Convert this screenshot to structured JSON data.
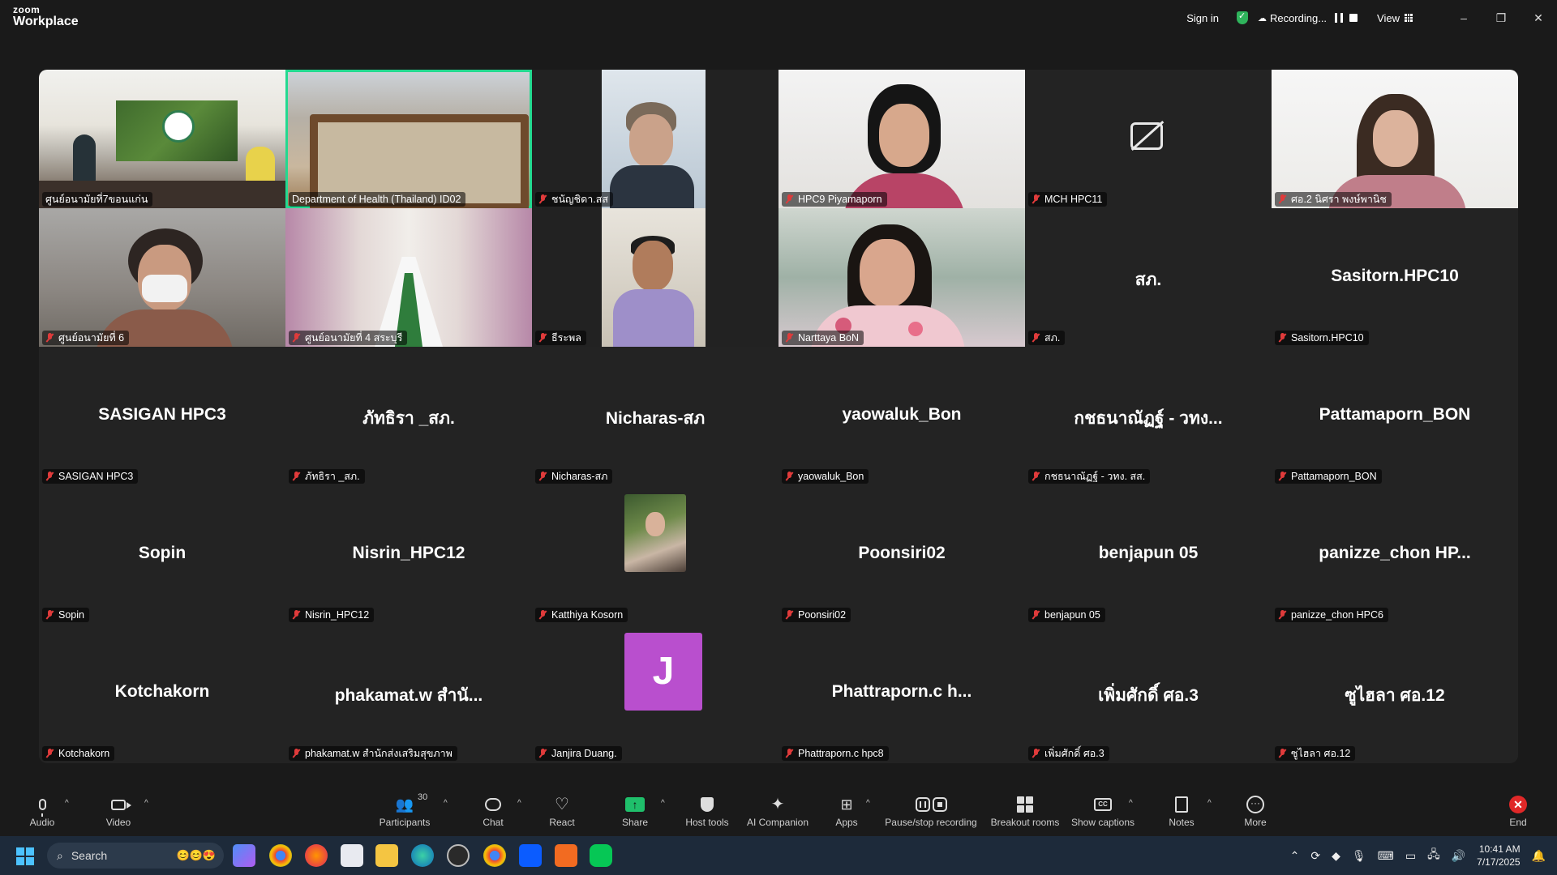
{
  "app": {
    "brand_top": "zoom",
    "brand_bottom": "Workplace"
  },
  "titlebar": {
    "signin": "Sign in",
    "recording": "Recording...",
    "view": "View",
    "minimize": "–",
    "restore": "❐",
    "close": "✕"
  },
  "tiles": [
    {
      "label": "ศูนย์อนามัยที่7ขอนแก่น",
      "big": "",
      "type": "video",
      "muted": false
    },
    {
      "label": "Department of Health (Thailand) ID02",
      "big": "",
      "type": "video",
      "muted": false,
      "active": true
    },
    {
      "label": "ชนัญชิดา.สส",
      "big": "",
      "type": "video",
      "muted": true
    },
    {
      "label": "HPC9 Piyamaporn",
      "big": "",
      "type": "video",
      "muted": true
    },
    {
      "label": "MCH HPC11",
      "big": "",
      "type": "camoff",
      "muted": true
    },
    {
      "label": "ศอ.2 นิศรา พงษ์พานิช",
      "big": "",
      "type": "video",
      "muted": true
    },
    {
      "label": "ศูนย์อนามัยที่ 6",
      "big": "",
      "type": "video",
      "muted": true
    },
    {
      "label": "ศูนย์อนามัยที่ 4 สระบุรี",
      "big": "",
      "type": "video",
      "muted": true
    },
    {
      "label": "ธีระพล",
      "big": "",
      "type": "video",
      "muted": true
    },
    {
      "label": "Narttaya BoN",
      "big": "",
      "type": "video",
      "muted": true
    },
    {
      "label": "สภ.",
      "big": "สภ.",
      "type": "name",
      "muted": true
    },
    {
      "label": "Sasitorn.HPC10",
      "big": "Sasitorn.HPC10",
      "type": "name",
      "muted": true
    },
    {
      "label": "SASIGAN HPC3",
      "big": "SASIGAN HPC3",
      "type": "name",
      "muted": true
    },
    {
      "label": "ภัทธิรา _สภ.",
      "big": "ภัทธิรา _สภ.",
      "type": "name",
      "muted": true
    },
    {
      "label": "Nicharas-สภ",
      "big": "Nicharas-สภ",
      "type": "name",
      "muted": true
    },
    {
      "label": "yaowaluk_Bon",
      "big": "yaowaluk_Bon",
      "type": "name",
      "muted": true
    },
    {
      "label": "กชธนาณัฏฐ์ - วทง. สส.",
      "big": "กชธนาณัฏฐ์ - วทง...",
      "type": "name",
      "muted": true
    },
    {
      "label": "Pattamaporn_BON",
      "big": "Pattamaporn_BON",
      "type": "name",
      "muted": true
    },
    {
      "label": "Sopin",
      "big": "Sopin",
      "type": "name",
      "muted": true
    },
    {
      "label": "Nisrin_HPC12",
      "big": "Nisrin_HPC12",
      "type": "name",
      "muted": true
    },
    {
      "label": "Katthiya Kosorn",
      "big": "",
      "type": "photo",
      "muted": true
    },
    {
      "label": "Poonsiri02",
      "big": "Poonsiri02",
      "type": "name",
      "muted": true
    },
    {
      "label": "benjapun 05",
      "big": "benjapun 05",
      "type": "name",
      "muted": true
    },
    {
      "label": "panizze_chon HPC6",
      "big": "panizze_chon HP...",
      "type": "name",
      "muted": true
    },
    {
      "label": "Kotchakorn",
      "big": "Kotchakorn",
      "type": "name",
      "muted": true
    },
    {
      "label": "phakamat.w สำนักส่งเสริมสุขภาพ",
      "big": "phakamat.w สำนั...",
      "type": "name",
      "muted": true
    },
    {
      "label": "Janjira Duang.",
      "big": "",
      "type": "initial",
      "initial": "J",
      "muted": true
    },
    {
      "label": "Phattraporn.c hpc8",
      "big": "Phattraporn.c h...",
      "type": "name",
      "muted": true
    },
    {
      "label": "เพิ่มศักดิ์ ศอ.3",
      "big": "เพิ่มศักดิ์ ศอ.3",
      "type": "name",
      "muted": true
    },
    {
      "label": "ซูไฮลา ศอ.12",
      "big": "ซูไฮลา ศอ.12",
      "type": "name",
      "muted": true
    }
  ],
  "toolbar": {
    "audio": "Audio",
    "video": "Video",
    "participants": "Participants",
    "participants_count": "30",
    "chat": "Chat",
    "react": "React",
    "share": "Share",
    "host_tools": "Host tools",
    "ai_companion": "AI Companion",
    "apps": "Apps",
    "recording": "Pause/stop recording",
    "breakout": "Breakout rooms",
    "captions": "Show captions",
    "notes": "Notes",
    "more": "More",
    "end": "End"
  },
  "taskbar": {
    "search_placeholder": "Search",
    "time": "10:41 AM",
    "date": "7/17/2025"
  },
  "colors": {
    "active_border": "#23d990",
    "share_green": "#1fbf6b",
    "end_red": "#e02828",
    "initial_bg": "#b94fce"
  }
}
